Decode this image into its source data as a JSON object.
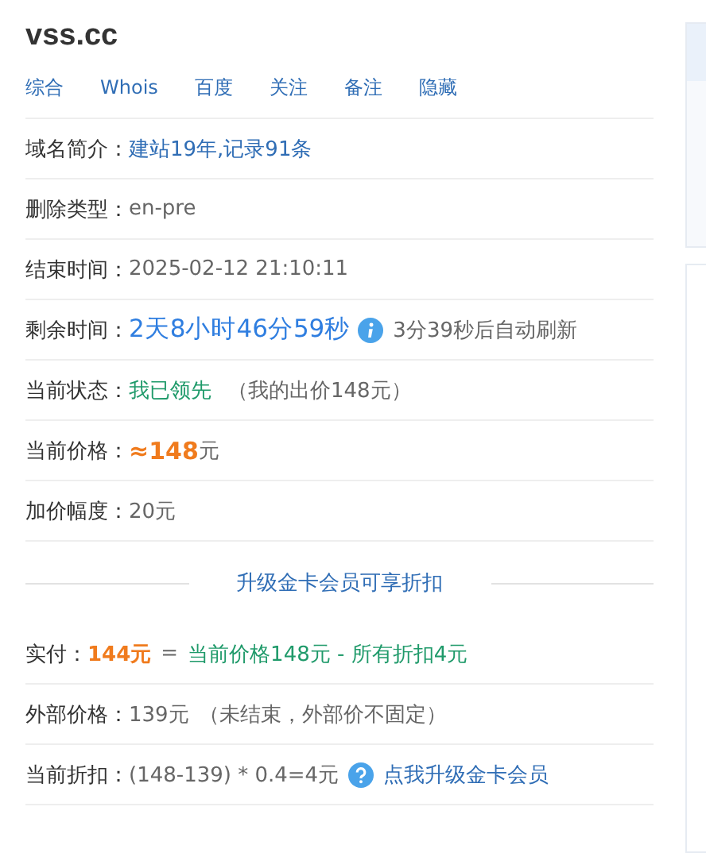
{
  "title": "vss.cc",
  "nav": [
    {
      "label": "综合"
    },
    {
      "label": "Whois"
    },
    {
      "label": "百度"
    },
    {
      "label": "关注"
    },
    {
      "label": "备注"
    },
    {
      "label": "隐藏"
    }
  ],
  "rows": [
    {
      "label": "域名简介：",
      "parts": [
        {
          "kind": "link",
          "text": "建站19年,记录91条"
        }
      ]
    },
    {
      "label": "删除类型：",
      "parts": [
        {
          "kind": "plain",
          "text": "en-pre"
        }
      ]
    },
    {
      "label": "结束时间：",
      "parts": [
        {
          "kind": "plain",
          "text": "2025-02-12 21:10:11"
        }
      ]
    },
    {
      "label": "剩余时间：",
      "parts": [
        {
          "kind": "countdown",
          "text": "2天8小时46分59秒"
        },
        {
          "kind": "info"
        },
        {
          "kind": "plain",
          "text": "3分39秒后自动刷新"
        }
      ]
    },
    {
      "label": "当前状态：",
      "parts": [
        {
          "kind": "green",
          "text": "我已领先"
        },
        {
          "kind": "plain",
          "text": "（我的出价148元）"
        }
      ]
    },
    {
      "label": "当前价格：",
      "parts": [
        {
          "kind": "price",
          "text": "≈148"
        },
        {
          "kind": "plain",
          "text": "元"
        }
      ]
    },
    {
      "label": "加价幅度：",
      "parts": [
        {
          "kind": "plain",
          "text": "20元"
        }
      ]
    }
  ],
  "divider": "升级金卡会员可享折扣",
  "summary": [
    {
      "label": "实付：",
      "parts": [
        {
          "kind": "pay",
          "text": "144元"
        },
        {
          "kind": "plain",
          "text": "="
        },
        {
          "kind": "green",
          "text": "当前价格148元 - 所有折扣4元"
        }
      ]
    },
    {
      "label": "外部价格：",
      "parts": [
        {
          "kind": "plain",
          "text": "139元"
        },
        {
          "kind": "plain",
          "text": "（未结束，外部价不固定）"
        }
      ]
    },
    {
      "label": "当前折扣：",
      "parts": [
        {
          "kind": "plain",
          "text": "(148-139) * 0.4=4元"
        },
        {
          "kind": "help"
        },
        {
          "kind": "link",
          "text": "点我升级金卡会员"
        }
      ]
    }
  ]
}
